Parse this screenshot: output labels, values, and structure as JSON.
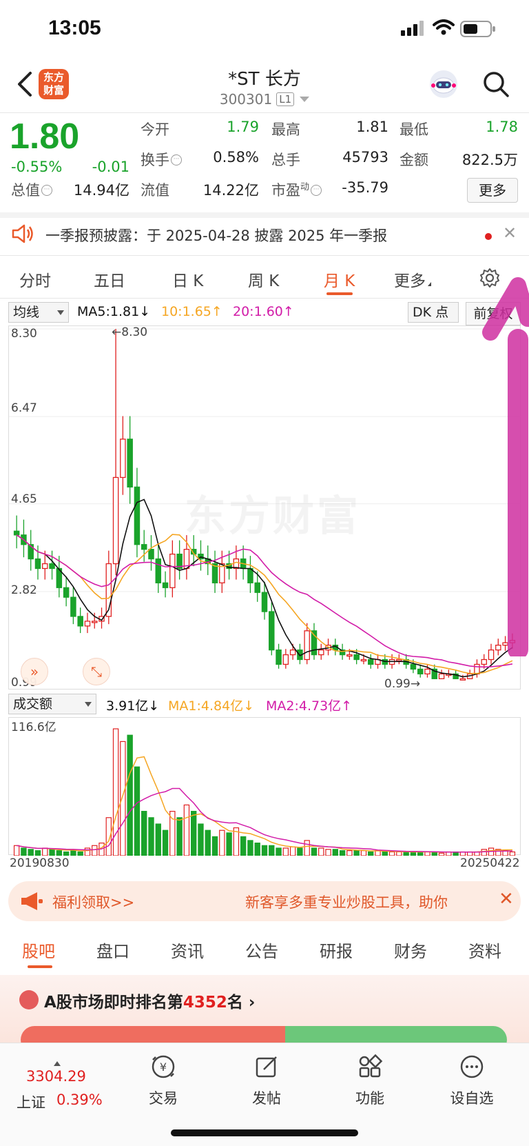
{
  "status_bar": {
    "time": "13:05"
  },
  "header": {
    "logo_line1": "东方",
    "logo_line2": "财富",
    "title": "*ST 长方",
    "code": "300301",
    "level": "L1"
  },
  "quote": {
    "price": "1.80",
    "change_pct": "-0.55%",
    "change": "-0.01",
    "fields": [
      {
        "label": "今开",
        "value": "1.79"
      },
      {
        "label": "最高",
        "value": "1.81"
      },
      {
        "label": "最低",
        "value": "1.78"
      },
      {
        "label": "换手",
        "value": "0.58%"
      },
      {
        "label": "总手",
        "value": "45793"
      },
      {
        "label": "金额",
        "value": "822.5万"
      },
      {
        "label": "总值",
        "value": "14.94亿"
      },
      {
        "label": "流值",
        "value": "14.22亿"
      },
      {
        "label": "市盈",
        "value": "-35.79"
      }
    ],
    "pe_sup": "动",
    "more_label": "更多"
  },
  "notice": {
    "text": "一季报预披露：于 2025-04-28 披露 2025 年一季报"
  },
  "period_tabs": [
    "分时",
    "五日",
    "日 K",
    "周 K",
    "月 K",
    "更多"
  ],
  "active_period": "月 K",
  "ma_legend": {
    "selector": "均线",
    "ma5": "MA5:1.81",
    "ma10": "10:1.65",
    "ma20": "20:1.60",
    "dk": "DK 点",
    "fq": "前复权"
  },
  "price_axis": [
    "8.30",
    "6.47",
    "4.65",
    "2.82",
    "0.99"
  ],
  "price_high_label": "8.30",
  "price_low_label": "0.99",
  "watermark": "东方财富",
  "vol_legend": {
    "selector": "成交额",
    "value": "3.91亿",
    "ma1": "MA1:4.84亿",
    "ma2": "MA2:4.73亿",
    "axis_top": "116.6亿"
  },
  "date_range": {
    "start": "20190830",
    "end": "20250422"
  },
  "colors": {
    "up": "#e02020",
    "down": "#1aa32b",
    "ma5": "#111111",
    "ma10": "#f5a623",
    "ma20": "#d21ca8",
    "accent": "#ea5a2b"
  },
  "promo": {
    "left": "福利领取>>",
    "right": "新客享多重专业炒股工具，助你"
  },
  "bottom_tabs": [
    "股吧",
    "盘口",
    "资讯",
    "公告",
    "研报",
    "财务",
    "资料"
  ],
  "active_bottom_tab": "股吧",
  "rank": {
    "prefix": "A股市场即时排名第",
    "number": "4352",
    "suffix": "名"
  },
  "bottom_nav": {
    "index_value": "3304.29",
    "index_name": "上证",
    "index_pct": "0.39%",
    "items": [
      {
        "label": "交易",
        "icon": "trade-icon"
      },
      {
        "label": "发帖",
        "icon": "post-icon"
      },
      {
        "label": "功能",
        "icon": "function-icon"
      },
      {
        "label": "设自选",
        "icon": "add-watchlist-icon"
      }
    ]
  },
  "chart_data": {
    "type": "candlestick",
    "period": "monthly",
    "y_axis": [
      0.99,
      8.3
    ],
    "high": 8.3,
    "low": 0.99,
    "last_close": 1.8,
    "ma_lines": [
      "MA5",
      "MA10",
      "MA20"
    ],
    "volume_axis_top": "116.6亿",
    "x_range": [
      "20190830",
      "20250422"
    ]
  }
}
